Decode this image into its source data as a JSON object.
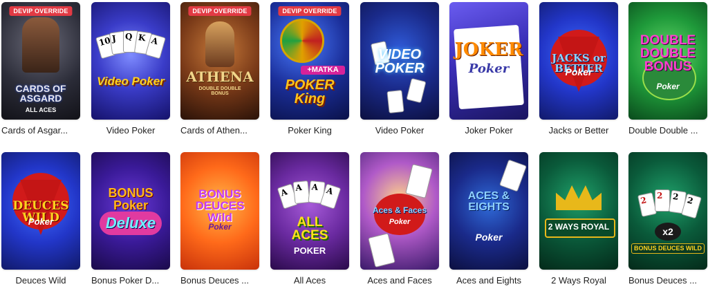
{
  "badge_label": "DEVIP OVERRIDE",
  "games": [
    {
      "title": "Cards of Asgar...",
      "logo": "CARDS OF ASGARD",
      "sub": "ALL ACES",
      "badge": true
    },
    {
      "title": "Video Poker",
      "logo": "Video Poker",
      "cards": [
        "10",
        "J",
        "Q",
        "K",
        "A"
      ]
    },
    {
      "title": "Cards of Athen...",
      "logo": "ATHENA",
      "sub": "DOUBLE DOUBLE BONUS",
      "badge": true
    },
    {
      "title": "Poker King",
      "logo": "POKER King",
      "sub": "+MATKA",
      "badge": true
    },
    {
      "title": "Video Poker",
      "logo": "VIDEO POKER"
    },
    {
      "title": "Joker Poker",
      "logo": "JOKER",
      "sub": "Poker"
    },
    {
      "title": "Jacks or Better",
      "logo": "JACKS or BETTER",
      "sub": "Poker"
    },
    {
      "title": "Double Double ...",
      "logo": "DOUBLE DOUBLE BONUS",
      "sub": "Poker"
    },
    {
      "title": "Deuces Wild",
      "logo": "DEUCES WILD",
      "sub": "Poker"
    },
    {
      "title": "Bonus Poker D...",
      "logo": "BONUS Poker",
      "sub": "Deluxe"
    },
    {
      "title": "Bonus Deuces ...",
      "logo": "BONUS DEUCES Wild",
      "sub": "Poker"
    },
    {
      "title": "All Aces",
      "logo": "ALL ACES",
      "sub": "POKER"
    },
    {
      "title": "Aces and Faces",
      "logo": "Aces & Faces",
      "sub": "Poker"
    },
    {
      "title": "Aces and Eights",
      "logo": "ACES & EIGHTS",
      "sub": "Poker"
    },
    {
      "title": "2 Ways Royal",
      "logo": "2 WAYS ROYAL"
    },
    {
      "title": "Bonus Deuces ...",
      "logo": "BONUS DEUCES WILD",
      "sub": "x2"
    }
  ]
}
